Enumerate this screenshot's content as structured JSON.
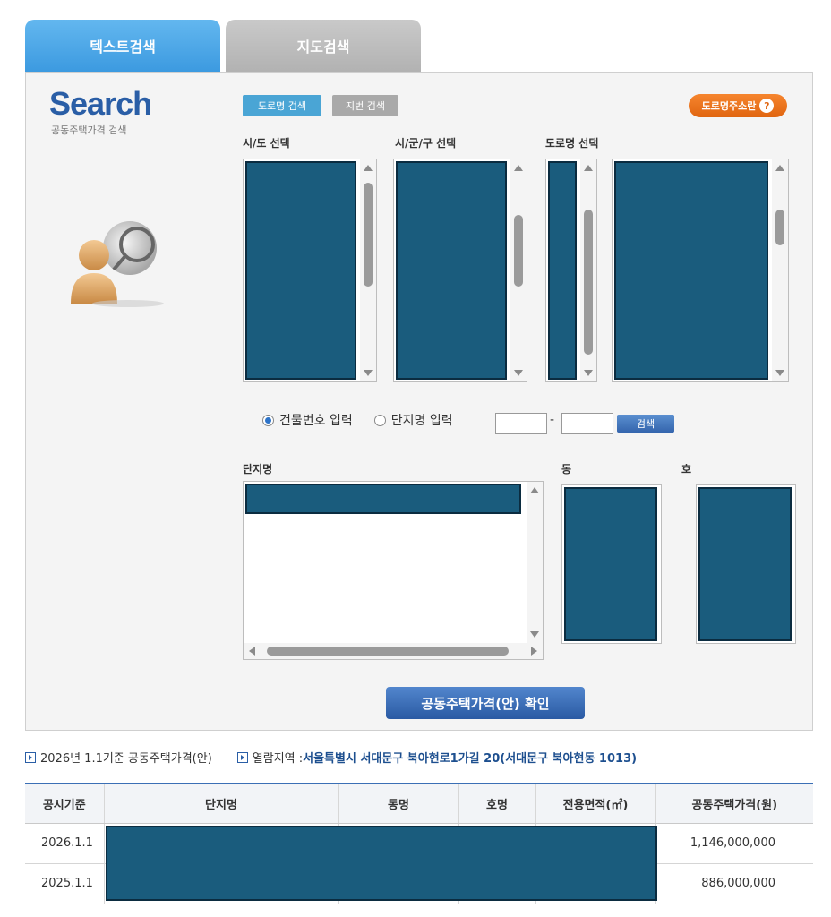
{
  "tabs": {
    "text_search": "텍스트검색",
    "map_search": "지도검색"
  },
  "logo": {
    "title": "Search",
    "subtitle": "공동주택가격 검색"
  },
  "buttons": {
    "road_search": "도로명 검색",
    "lot_search": "지번 검색",
    "road_guide": "도로명주소란",
    "guide_icon": "?",
    "search": "검색",
    "confirm": "공동주택가격(안) 확인"
  },
  "labels": {
    "sido": "시/도 선택",
    "sigungu": "시/군/구 선택",
    "road": "도로명 선택",
    "complex": "단지명",
    "dong": "동",
    "ho": "호",
    "dash": "-"
  },
  "radio": {
    "building_number": "건물번호 입력",
    "complex_name": "단지명 입력",
    "selected": "building_number"
  },
  "info": {
    "base": "2026년 1.1기준 공동주택가격(안)",
    "region_label": "열람지역 : ",
    "region_value": "서울특별시 서대문구 북아현로1가길 20(서대문구 북아현동 1013)"
  },
  "table": {
    "headers": [
      "공시기준",
      "단지명",
      "동명",
      "호명",
      "전용면적(㎡)",
      "공동주택가격(원)"
    ],
    "rows": [
      {
        "year": "2026.1.1",
        "price": "1,146,000,000"
      },
      {
        "year": "2025.1.1",
        "price": "886,000,000"
      }
    ]
  },
  "icons": {
    "avatar": "user-search-icon"
  },
  "colors": {
    "accent": "#3c9ae0",
    "redaction": "#1a5c7d",
    "guide_orange": "#e06510"
  }
}
